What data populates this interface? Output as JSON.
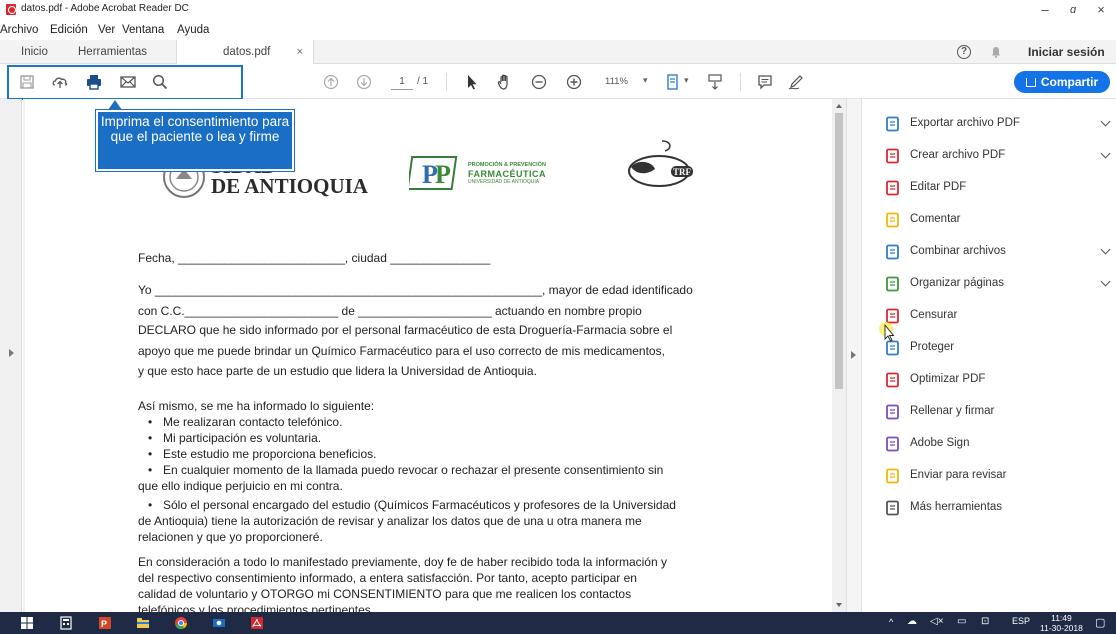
{
  "window": {
    "title": "datos.pdf - Adobe Acrobat Reader DC",
    "minimize": "–",
    "maximize": "ɑ",
    "close": "×"
  },
  "menu": [
    "Archivo",
    "Edición",
    "Ver",
    "Ventana",
    "Ayuda"
  ],
  "tabs": {
    "home": "Inicio",
    "tools": "Herramientas",
    "document": "datos.pdf",
    "close": "×"
  },
  "header": {
    "help": "?",
    "signin": "Iniciar sesión"
  },
  "toolbar": {
    "page_current": "1",
    "page_total": "/ 1",
    "zoom": "111%",
    "zoom_dropdown": "▾",
    "share": "Compartir"
  },
  "callout": {
    "text": "Imprima el consentimiento para que el paciente o lea y firme"
  },
  "document": {
    "logo_udea_line1": "SIDAD",
    "logo_udea_line2": "DE ANTIOQUIA",
    "logo_pp_line1": "PROMOCIÓN & PREVENCIÓN",
    "logo_pp_line2": "FARMACÉUTICA",
    "logo_pp_line3": "UNIVERSIDAD DE ANTIOQUIA",
    "logo_trf": "TRF",
    "fecha_line": "Fecha, _________________________, ciudad _______________",
    "yo_line": "Yo __________________________________________________________, mayor de edad identificado",
    "cc_line": "con C.C._______________________ de ____________________ actuando en nombre propio",
    "declaro_line1": "DECLARO que he sido informado por el personal farmacéutico de esta Droguería-Farmacia sobre el",
    "declaro_line2": "apoyo que me puede brindar un Químico Farmacéutico para el uso correcto de mis medicamentos,",
    "declaro_line3": "y que esto hace parte de un estudio que lidera la Universidad de Antioquia.",
    "asi_mismo": "Así mismo, se me ha informado lo siguiente:",
    "bullets": [
      "Me realizaran contacto telefónico.",
      "Mi participación es voluntaria.",
      "Este estudio me proporciona beneficios.",
      "En cualquier momento de la llamada puedo revocar o rechazar el presente consentimiento sin",
      "Sólo el personal encargado del estudio (Químicos Farmacéuticos y profesores de la Universidad"
    ],
    "bullet4_cont": "que ello indique perjuicio en mi contra.",
    "bullet5_cont1": "de Antioquia) tiene la autorización de revisar y analizar los datos que de una u otra manera me",
    "bullet5_cont2": "relacionen y que yo proporcioneré.",
    "consid_line1": "En consideración a todo lo manifestado previamente, doy fe de haber recibido toda la información y",
    "consid_line2": "del respectivo consentimiento informado, a entera satisfacción. Por tanto, acepto participar en",
    "consid_line3": "calidad de voluntario y OTORGO mi CONSENTIMIENTO para que me realicen los contactos",
    "consid_line4": "telefónicos y los procedimientos pertinentes."
  },
  "tools": [
    {
      "label": "Exportar archivo PDF",
      "icon": "export-pdf-icon",
      "color": "#2d7dd2",
      "expandable": true
    },
    {
      "label": "Crear archivo PDF",
      "icon": "create-pdf-icon",
      "color": "#d7282f",
      "expandable": true
    },
    {
      "label": "Editar PDF",
      "icon": "edit-pdf-icon",
      "color": "#d7282f",
      "expandable": false
    },
    {
      "label": "Comentar",
      "icon": "comment-icon",
      "color": "#f2b807",
      "expandable": false
    },
    {
      "label": "Combinar archivos",
      "icon": "combine-icon",
      "color": "#2d7dd2",
      "expandable": true
    },
    {
      "label": "Organizar páginas",
      "icon": "organize-icon",
      "color": "#3a9a3a",
      "expandable": true
    },
    {
      "label": "Censurar",
      "icon": "redact-icon",
      "color": "#d7282f",
      "expandable": false
    },
    {
      "label": "Proteger",
      "icon": "protect-icon",
      "color": "#2d7dd2",
      "expandable": false
    },
    {
      "label": "Optimizar PDF",
      "icon": "optimize-icon",
      "color": "#d7282f",
      "expandable": false
    },
    {
      "label": "Rellenar y firmar",
      "icon": "fill-sign-icon",
      "color": "#7b4cc4",
      "expandable": false
    },
    {
      "label": "Adobe Sign",
      "icon": "adobe-sign-icon",
      "color": "#7b4cc4",
      "expandable": false
    },
    {
      "label": "Enviar para revisar",
      "icon": "send-review-icon",
      "color": "#f2b807",
      "expandable": false
    },
    {
      "label": "Más herramientas",
      "icon": "more-tools-icon",
      "color": "#555555",
      "expandable": false
    }
  ],
  "taskbar": {
    "lang": "ESP",
    "time": "11:49",
    "date": "11-30-2018"
  }
}
